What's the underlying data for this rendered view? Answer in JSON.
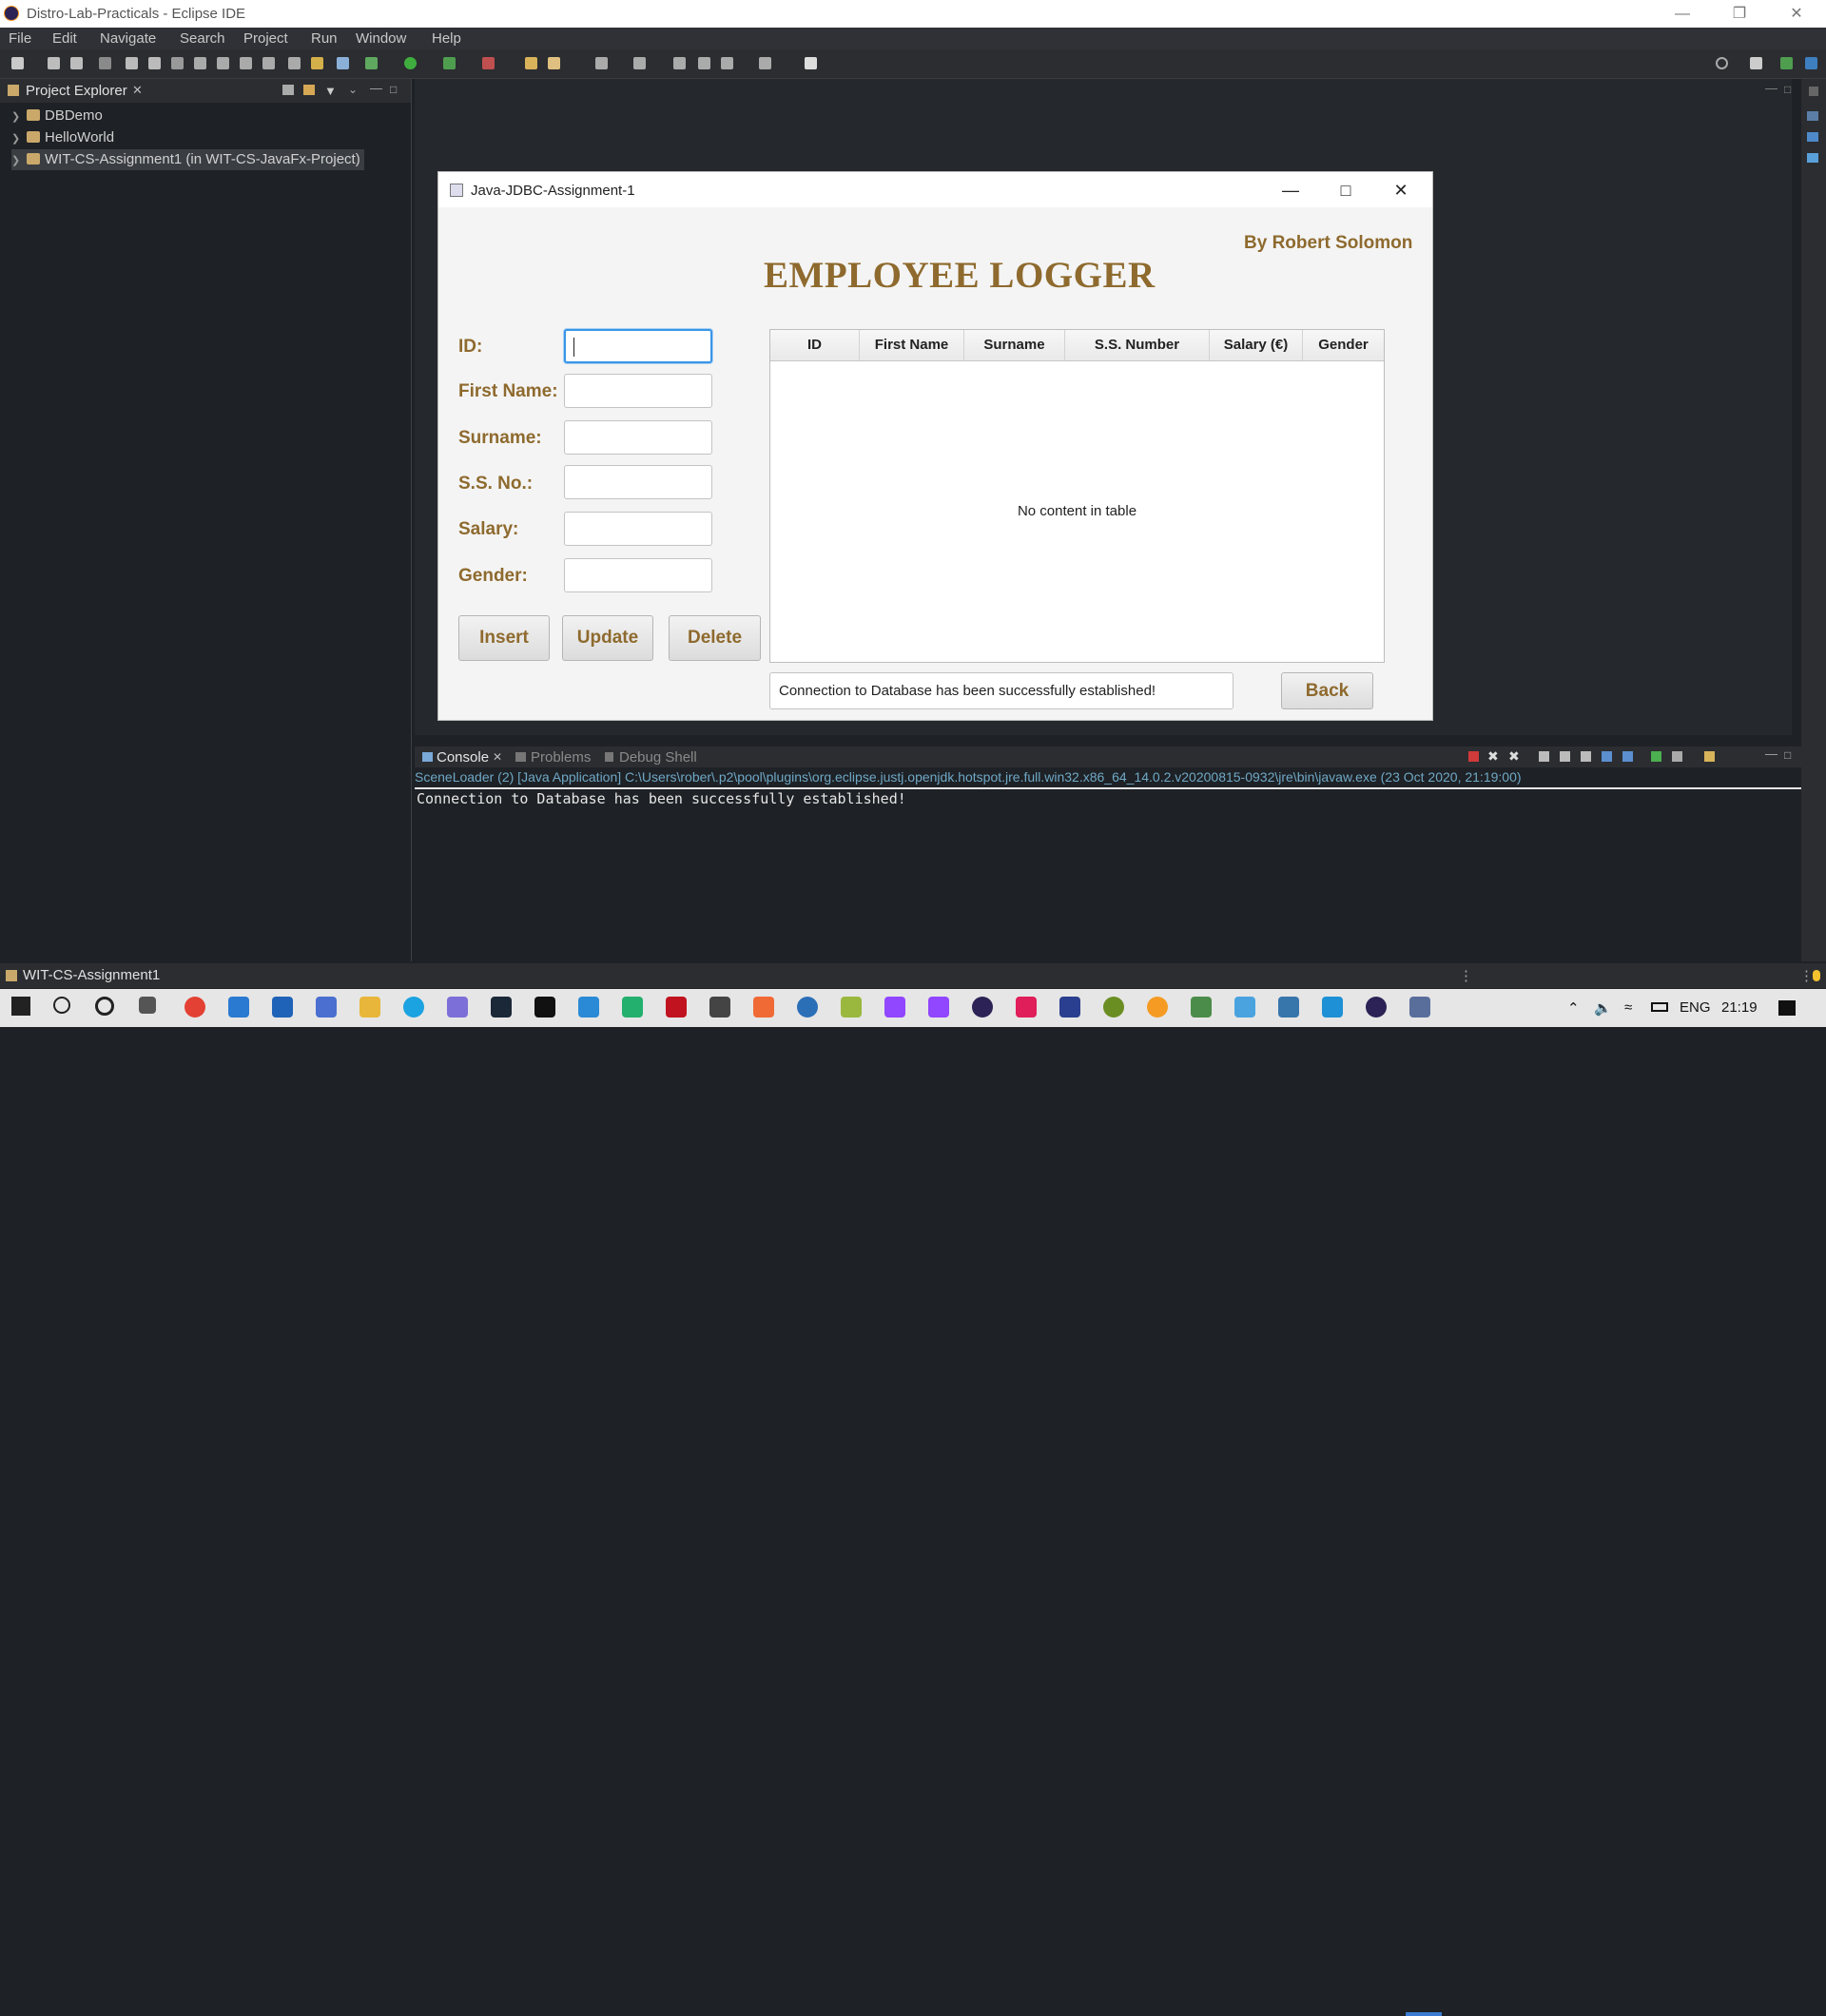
{
  "window": {
    "title": "Distro-Lab-Practicals - Eclipse IDE"
  },
  "menu": [
    "File",
    "Edit",
    "Navigate",
    "Search",
    "Project",
    "Run",
    "Window",
    "Help"
  ],
  "explorer": {
    "title": "Project Explorer",
    "items": [
      "DBDemo",
      "HelloWorld",
      "WIT-CS-Assignment1 (in WIT-CS-JavaFx-Project)"
    ]
  },
  "app": {
    "title": "Java-JDBC-Assignment-1",
    "author": "By Robert Solomon",
    "heading": "EMPLOYEE LOGGER",
    "fields": [
      {
        "label": "ID:",
        "value": ""
      },
      {
        "label": "First Name:",
        "value": ""
      },
      {
        "label": "Surname:",
        "value": ""
      },
      {
        "label": "S.S. No.:",
        "value": ""
      },
      {
        "label": "Salary:",
        "value": ""
      },
      {
        "label": "Gender:",
        "value": ""
      }
    ],
    "buttons": {
      "insert": "Insert",
      "update": "Update",
      "delete": "Delete",
      "back": "Back"
    },
    "table": {
      "columns": [
        "ID",
        "First Name",
        "Surname",
        "S.S. Number",
        "Salary (€)",
        "Gender"
      ],
      "empty_message": "No content in table"
    },
    "status": "Connection to Database has been successfully established!"
  },
  "console": {
    "tabs": [
      "Console",
      "Problems",
      "Debug Shell"
    ],
    "launch_info": "SceneLoader (2) [Java Application] C:\\Users\\rober\\.p2\\pool\\plugins\\org.eclipse.justj.openjdk.hotspot.jre.full.win32.x86_64_14.0.2.v20200815-0932\\jre\\bin\\javaw.exe  (23 Oct 2020, 21:19:00)",
    "output": "Connection to Database has been successfully established!"
  },
  "statusbar": {
    "selection": "WIT-CS-Assignment1"
  },
  "taskbar": {
    "language": "ENG",
    "time": "21:19"
  },
  "colors": {
    "accent": "#8e6a2e",
    "focus": "#3a95e6"
  }
}
